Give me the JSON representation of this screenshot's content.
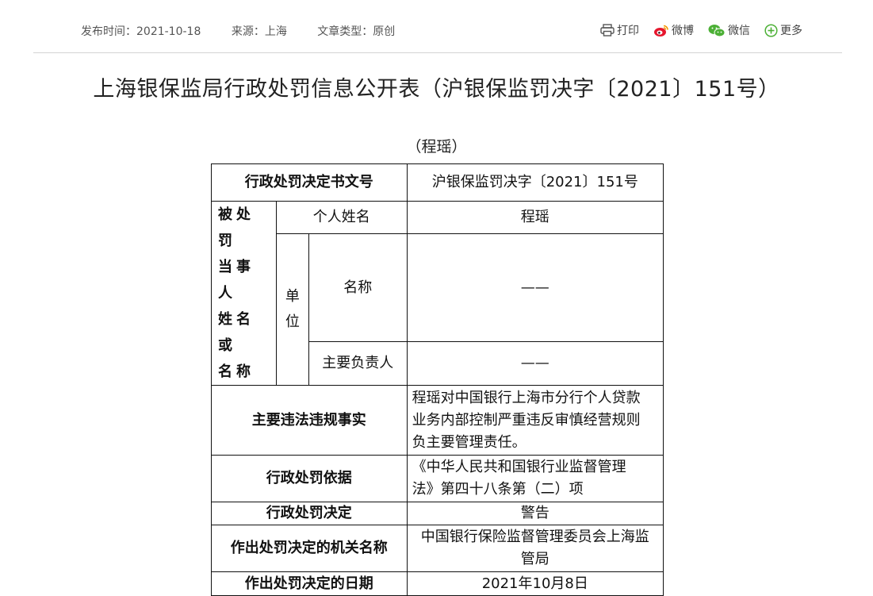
{
  "meta": {
    "publish_time": "发布时间：2021-10-18",
    "source": "来源：上海",
    "article_type": "文章类型：原创"
  },
  "share": {
    "print": "打印",
    "weibo": "微博",
    "wechat": "微信",
    "more": "更多"
  },
  "title": "上海银保监局行政处罚信息公开表（沪银保监罚决字〔2021〕151号）",
  "subtitle": "（程瑶）",
  "table": {
    "doc_no_label": "行政处罚决定书文号",
    "doc_no_value": "沪银保监罚决字〔2021〕151号",
    "party_label_lines": [
      "被处罚",
      "当事人",
      "姓名或",
      "名称"
    ],
    "person_label": "个人姓名",
    "person_value": "程瑶",
    "unit_label_lines": [
      "单",
      "位"
    ],
    "unit_name_label": "名称",
    "unit_name_value": "——",
    "unit_head_label": "主要负责人",
    "unit_head_value": "——",
    "facts_label": "主要违法违规事实",
    "facts_lines": [
      "程瑶对中国银行上海市分行个人贷款",
      "业务内部控制严重违反审慎经营规则",
      "负主要管理责任。"
    ],
    "basis_label": "行政处罚依据",
    "basis_lines": [
      "《中华人民共和国银行业监督管理",
      "法》第四十八条第（二）项"
    ],
    "decision_label": "行政处罚决定",
    "decision_value": "警告",
    "authority_label": "作出处罚决定的机关名称",
    "authority_lines": [
      "中国银行保险监督管理委员会上海监",
      "管局"
    ],
    "date_label": "作出处罚决定的日期",
    "date_value": "2021年10月8日"
  }
}
